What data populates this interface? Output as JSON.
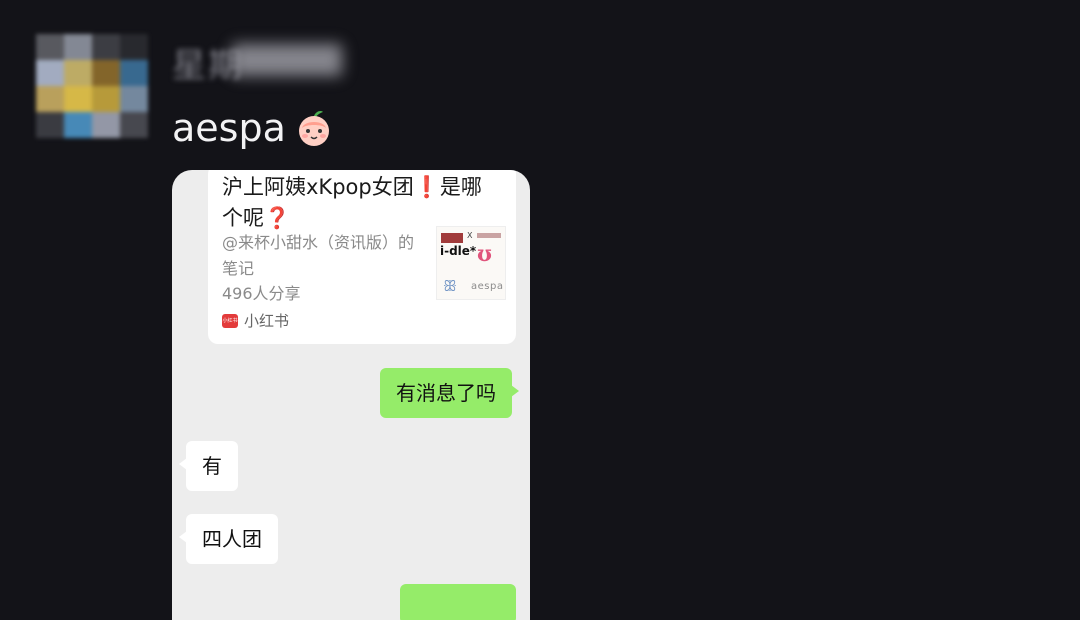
{
  "sender": {
    "name": "星期",
    "avatar_colors": [
      "#5c5d63",
      "#8a8f9b",
      "#3f4046",
      "#2a2b30",
      "#aab4c9",
      "#c7b46a",
      "#8a6a2c",
      "#3b6e96",
      "#c2a860",
      "#e1c14a",
      "#c0a23c",
      "#7a8fa6",
      "#3d3e44",
      "#4a90c0",
      "#9a9fae",
      "#4a4b52"
    ]
  },
  "caption": {
    "text": "aespa",
    "emoji": "peach-face"
  },
  "chat": {
    "share_card": {
      "title": "沪上阿姨xKpop女团",
      "title_mark_1": "❗",
      "title_part_2": "是哪个呢",
      "title_mark_2": "❓",
      "author_line": "@来杯小甜水（资讯版）的笔记",
      "shares": "496人分享",
      "source": "小红书",
      "source_icon_text": "小红书",
      "thumbnail": {
        "x_mark": "X",
        "brand_idle": "i-dle*",
        "brand_twice": "ʊ",
        "brand_butterfly": "ꕥ",
        "brand_aespa": "aespa"
      }
    },
    "messages": [
      {
        "side": "out",
        "text": "有消息了吗"
      },
      {
        "side": "in",
        "text": "有"
      },
      {
        "side": "in",
        "text": "四人团"
      }
    ]
  },
  "colors": {
    "background": "#131318",
    "chat_bg": "#ededed",
    "outgoing_bubble": "#95ec69",
    "incoming_bubble": "#ffffff",
    "accent_red": "#e02424"
  }
}
